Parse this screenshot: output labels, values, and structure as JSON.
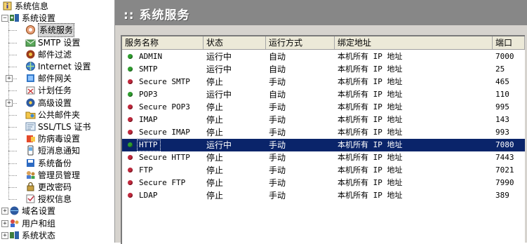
{
  "tree": {
    "items": [
      {
        "label": "系统信息",
        "icon": "info-icon",
        "level": 0,
        "expand": null
      },
      {
        "label": "系统设置",
        "icon": "settings-icon",
        "level": 0,
        "expand": "−"
      },
      {
        "label": "系统服务",
        "icon": "service-icon",
        "level": 1,
        "expand": null,
        "selected": true
      },
      {
        "label": "SMTP 设置",
        "icon": "smtp-icon",
        "level": 1,
        "expand": null
      },
      {
        "label": "邮件过滤",
        "icon": "filter-icon",
        "level": 1,
        "expand": null
      },
      {
        "label": "Internet 设置",
        "icon": "internet-icon",
        "level": 1,
        "expand": null
      },
      {
        "label": "邮件网关",
        "icon": "gateway-icon",
        "level": 1,
        "expand": "+"
      },
      {
        "label": "计划任务",
        "icon": "schedule-icon",
        "level": 1,
        "expand": null
      },
      {
        "label": "高级设置",
        "icon": "advanced-icon",
        "level": 1,
        "expand": "+"
      },
      {
        "label": "公共邮件夹",
        "icon": "public-folder-icon",
        "level": 1,
        "expand": null
      },
      {
        "label": "SSL/TLS 证书",
        "icon": "certificate-icon",
        "level": 1,
        "expand": null
      },
      {
        "label": "防病毒设置",
        "icon": "antivirus-icon",
        "level": 1,
        "expand": null
      },
      {
        "label": "短消息通知",
        "icon": "sms-icon",
        "level": 1,
        "expand": null
      },
      {
        "label": "系统备份",
        "icon": "backup-icon",
        "level": 1,
        "expand": null
      },
      {
        "label": "管理员管理",
        "icon": "admin-icon",
        "level": 1,
        "expand": null
      },
      {
        "label": "更改密码",
        "icon": "password-icon",
        "level": 1,
        "expand": null
      },
      {
        "label": "授权信息",
        "icon": "license-icon",
        "level": 1,
        "expand": null
      },
      {
        "label": "域名设置",
        "icon": "domain-icon",
        "level": 0,
        "expand": "+"
      },
      {
        "label": "用户和组",
        "icon": "users-icon",
        "level": 0,
        "expand": "+"
      },
      {
        "label": "系统状态",
        "icon": "status-icon",
        "level": 0,
        "expand": "+"
      }
    ]
  },
  "header": {
    "title": ":: 系统服务"
  },
  "table": {
    "columns": [
      "服务名称",
      "状态",
      "运行方式",
      "绑定地址",
      "端口"
    ],
    "rows": [
      {
        "name": "ADMIN",
        "status": "运行中",
        "mode": "自动",
        "bind": "本机所有 IP 地址",
        "port": "7000",
        "state": "green"
      },
      {
        "name": "SMTP",
        "status": "运行中",
        "mode": "自动",
        "bind": "本机所有 IP 地址",
        "port": "25",
        "state": "green"
      },
      {
        "name": "Secure SMTP",
        "status": "停止",
        "mode": "手动",
        "bind": "本机所有 IP 地址",
        "port": "465",
        "state": "red"
      },
      {
        "name": "POP3",
        "status": "运行中",
        "mode": "自动",
        "bind": "本机所有 IP 地址",
        "port": "110",
        "state": "green"
      },
      {
        "name": "Secure POP3",
        "status": "停止",
        "mode": "手动",
        "bind": "本机所有 IP 地址",
        "port": "995",
        "state": "red"
      },
      {
        "name": "IMAP",
        "status": "停止",
        "mode": "手动",
        "bind": "本机所有 IP 地址",
        "port": "143",
        "state": "red"
      },
      {
        "name": "Secure IMAP",
        "status": "停止",
        "mode": "手动",
        "bind": "本机所有 IP 地址",
        "port": "993",
        "state": "red"
      },
      {
        "name": "HTTP",
        "status": "运行中",
        "mode": "手动",
        "bind": "本机所有 IP 地址",
        "port": "7080",
        "state": "green",
        "selected": true
      },
      {
        "name": "Secure HTTP",
        "status": "停止",
        "mode": "手动",
        "bind": "本机所有 IP 地址",
        "port": "7443",
        "state": "red"
      },
      {
        "name": "FTP",
        "status": "停止",
        "mode": "手动",
        "bind": "本机所有 IP 地址",
        "port": "7021",
        "state": "red"
      },
      {
        "name": "Secure FTP",
        "status": "停止",
        "mode": "手动",
        "bind": "本机所有 IP 地址",
        "port": "7990",
        "state": "red"
      },
      {
        "name": "LDAP",
        "status": "停止",
        "mode": "手动",
        "bind": "本机所有 IP 地址",
        "port": "389",
        "state": "red"
      }
    ]
  },
  "colors": {
    "header_bg": "#878787",
    "selection": "#0a246a",
    "running": "#2f9d2f",
    "stopped": "#c0283c"
  }
}
